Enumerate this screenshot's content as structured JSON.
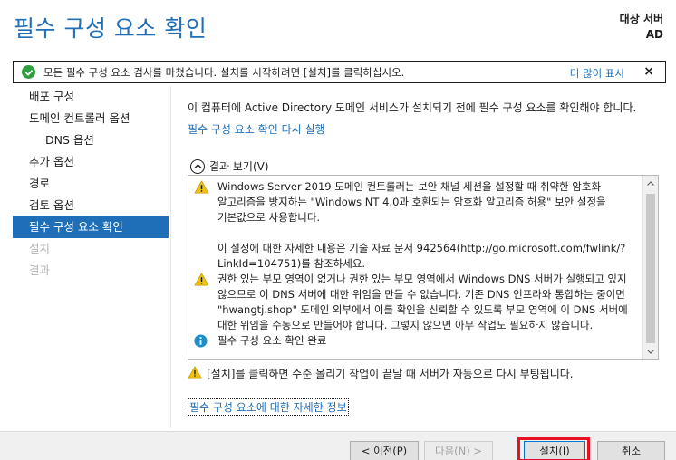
{
  "header": {
    "title": "필수 구성 요소 확인",
    "target_server_label": "대상 서버",
    "target_server_name": "AD"
  },
  "status_bar": {
    "message": "모든 필수 구성 요소 검사를 마쳤습니다. 설치를 시작하려면 [설치]를 클릭하십시오.",
    "more_link": "더 많이 표시",
    "close_glyph": "×"
  },
  "nav": {
    "items": [
      {
        "label": "배포 구성"
      },
      {
        "label": "도메인 컨트롤러 옵션"
      },
      {
        "label": "DNS 옵션"
      },
      {
        "label": "추가 옵션"
      },
      {
        "label": "경로"
      },
      {
        "label": "검토 옵션"
      },
      {
        "label": "필수 구성 요소 확인"
      },
      {
        "label": "설치"
      },
      {
        "label": "결과"
      }
    ]
  },
  "main": {
    "description": "이 컴퓨터에 Active Directory 도메인 서비스가 설치되기 전에 필수 구성 요소를 확인해야 합니다.",
    "rerun_link": "필수 구성 요소 확인 다시 실행",
    "results_header": "결과 보기(V)",
    "results": [
      {
        "icon": "warning-icon",
        "text1": "Windows Server 2019 도메인 컨트롤러는 보안 채널 세션을 설정할 때 취약한 암호화 알고리즘을 방지하는 \"Windows NT 4.0과 호환되는 암호화 알고리즘 허용\" 보안 설정을 기본값으로 사용합니다.",
        "text2": "이 설정에 대한 자세한 내용은 기술 자료 문서 942564(http://go.microsoft.com/fwlink/?LinkId=104751)를 참조하세요."
      },
      {
        "icon": "warning-icon",
        "text1": "권한 있는 부모 영역이 없거나 권한 있는 부모 영역에서 Windows DNS 서버가 실행되고 있지 않으므로 이 DNS 서버에 대한 위임을 만들 수 없습니다. 기존 DNS 인프라와 통합하는 중이면 \"hwangtj.shop\" 도메인 외부에서 이를 확인을 신뢰할 수 있도록 부모 영역에 이 DNS 서버에 대한 위임을 수동으로 만들어야 합니다. 그렇지 않으면 아무 작업도 필요하지 않습니다."
      },
      {
        "icon": "info-icon",
        "text1": "필수 구성 요소 확인 완료"
      }
    ],
    "reboot_note": "[설치]를 클릭하면 수준 올리기 작업이 끝날 때 서버가 자동으로 다시 부팅됩니다.",
    "more_info_link": "필수 구성 요소에 대한 자세한 정보"
  },
  "footer": {
    "prev_label": "< 이전(P)",
    "next_label": "다음(N) >",
    "install_label": "설치(I)",
    "cancel_label": "취소"
  },
  "colors": {
    "accent": "#1f6fb8",
    "warning": "#f2c211",
    "info": "#1a8fc9",
    "ok": "#2e9e3f",
    "highlight": "#e81123"
  }
}
